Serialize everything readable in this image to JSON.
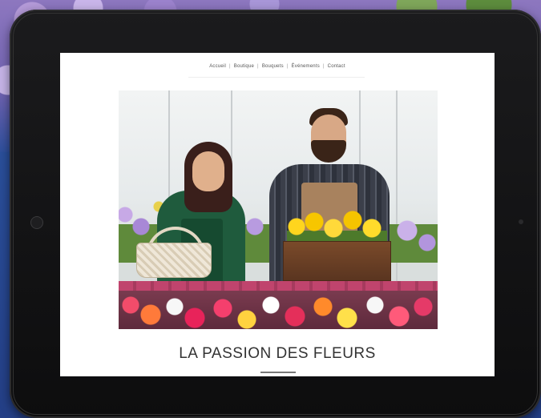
{
  "nav": {
    "items": [
      "Accueil",
      "Boutique",
      "Bouquets",
      "Événements",
      "Contact"
    ],
    "separator": "|"
  },
  "hero": {
    "title": "LA PASSION DES FLEURS"
  }
}
